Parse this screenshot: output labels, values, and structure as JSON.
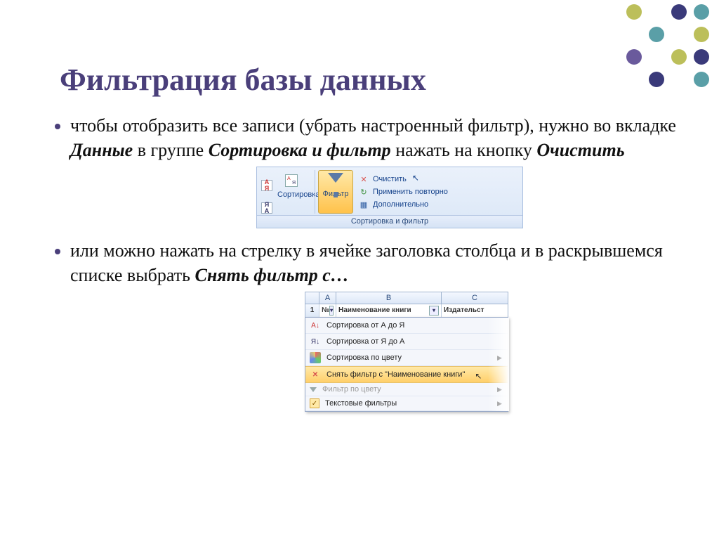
{
  "slide": {
    "title": "Фильтрация базы данных",
    "bullet1": {
      "p1": "чтобы отобразить все записи (убрать настроенный фильтр), нужно во вкладке ",
      "k1": "Данные",
      "p2": " в группе ",
      "k2": "Сортировка и фильтр",
      "p3": " нажать на кнопку ",
      "k3": "Очистить"
    },
    "bullet2": {
      "p1": "или можно нажать на стрелку в ячейке заголовка столбца и в раскрывшемся списке выбрать ",
      "k1": "Снять фильтр с…"
    }
  },
  "ribbon": {
    "sort_btn": "Сортировка",
    "filter_btn": "Фильтр",
    "clear": "Очистить",
    "reapply": "Применить повторно",
    "advanced": "Дополнительно",
    "group_caption": "Сортировка и фильтр",
    "az_asc": "А\nЯ",
    "az_desc": "Я\nА"
  },
  "sheet": {
    "columns": [
      "A",
      "B",
      "C"
    ],
    "row_num": "1",
    "h1": "№",
    "h2": "Наименование книги",
    "h3": "Издательст"
  },
  "menu": {
    "sort_asc": "Сортировка от А до Я",
    "sort_desc": "Сортировка от Я до А",
    "sort_color": "Сортировка по цвету",
    "clear_filter": "Снять фильтр с \"Наименование книги\"",
    "filter_color": "Фильтр по цвету",
    "text_filters": "Текстовые фильтры"
  }
}
